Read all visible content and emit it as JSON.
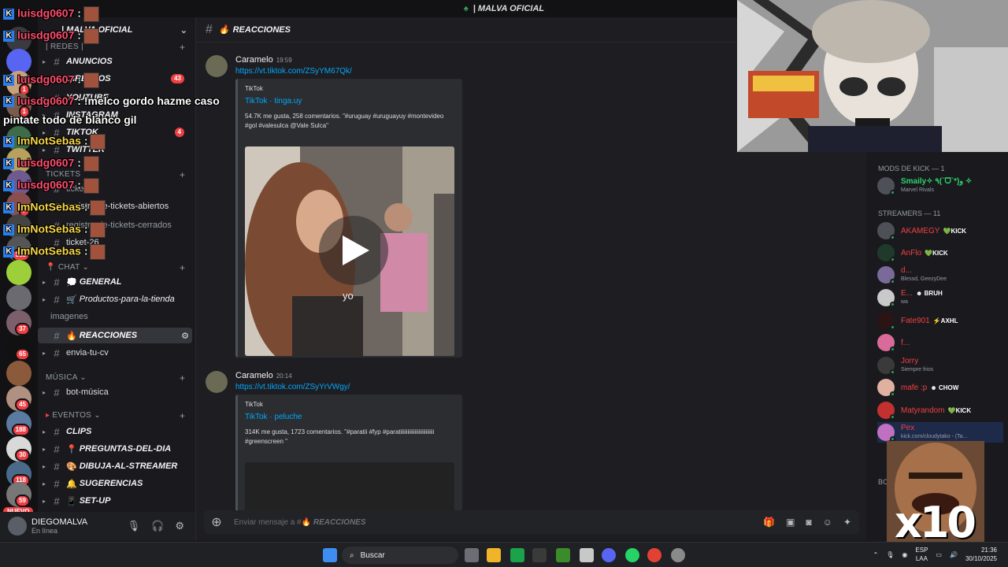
{
  "window": {
    "title": "| MALVA OFICIAL"
  },
  "server": {
    "name": "| MALVA OFICIAL"
  },
  "rail": {
    "badges": [
      "1",
      "1",
      "7",
      "4",
      "5",
      "7",
      "2",
      "383",
      "37",
      "65",
      "45",
      "188",
      "30",
      "118",
      "59"
    ],
    "nuevo_label": "NUEVO"
  },
  "sidebar": {
    "categories": {
      "redes": "| REDES |",
      "tickets": "TICKETS",
      "chat": "CHAT",
      "musica": "MÚSICA",
      "eventos": "EVENTOS"
    },
    "redes_channels": [
      "ANUNCIOS",
      "DIRECTOS",
      "YOUTUBE",
      "INSTAGRAM",
      "TIKTOK",
      "TWITTER"
    ],
    "directos_count": "43",
    "tiktok_count": "4",
    "tickets_channels": [
      "tickets",
      "registro-de-tickets-abiertos",
      "registro-de-tickets-cerrados",
      "ticket-26"
    ],
    "chat_channels": [
      "GENERAL",
      "Productos-para-la-tienda",
      "imagenes",
      "REACCIONES",
      "envia-tu-cv"
    ],
    "musica_channels": [
      "bot-música"
    ],
    "eventos_channels": [
      "CLIPS",
      "PREGUNTAS-DEL-DIA",
      "DIBUJA-AL-STREAMER",
      "SUGERENCIAS",
      "SET-UP"
    ]
  },
  "user": {
    "name": "DIEGOMALVA",
    "status": "En línea"
  },
  "channel": {
    "name": "REACCIONES"
  },
  "messages": [
    {
      "author": "Caramelo",
      "time": "19:59",
      "link": "https://vt.tiktok.com/ZSyYM67Qk/",
      "provider": "TikTok",
      "title": "TikTok · tinga.uy",
      "description": "54.7K me gusta, 258 comentarios. \"#uruguay #uruguayuy #montevideo #gol #valesulca @Vale Sulca\"",
      "video_caption": "yo"
    },
    {
      "author": "Caramelo",
      "time": "20:14",
      "link": "https://vt.tiktok.com/ZSyYrVWgy/",
      "provider": "TikTok",
      "title": "TikTok · peluche",
      "description": "314K me gusta, 1723 comentarios. \"#paratii #fyp #paratiiiiiiiiiiiiiiiiiiiiiiii #greenscreen \""
    }
  ],
  "composer": {
    "prefix": "Enviar mensaje a #",
    "channel": "REACCIONES"
  },
  "members": {
    "mods_header": "MODS DE KICK — 1",
    "streamers_header": "STREAMERS — 11",
    "bots_header": "BO",
    "mods": [
      {
        "name": "Smaily✧ ٩(ˊᗜˋ*)و ✧",
        "status": "Marvel Rivals",
        "color": "#2dd36f"
      }
    ],
    "streamers": [
      {
        "name": "AKAMEGY",
        "tag": "KICK",
        "status": "",
        "color": "#f23f43"
      },
      {
        "name": "AnFlo",
        "tag": "KICK",
        "status": "",
        "color": "#f23f43"
      },
      {
        "name": "d...",
        "tag": "",
        "status": "Blessd, GeezyDee",
        "color": "#f23f43"
      },
      {
        "name": "E...",
        "tag": "BRUH",
        "status": "wa",
        "color": "#f23f43"
      },
      {
        "name": "Fate901",
        "tag": "AXHL",
        "status": "",
        "color": "#f23f43"
      },
      {
        "name": "f...",
        "tag": "",
        "status": "",
        "color": "#f23f43"
      },
      {
        "name": "Jorry",
        "tag": "",
        "status": "Siempre frios",
        "color": "#f23f43"
      },
      {
        "name": "mafe :p",
        "tag": "CHOW",
        "status": "",
        "color": "#f23f43"
      },
      {
        "name": "Matyrandom",
        "tag": "KICK",
        "status": "",
        "color": "#f23f43"
      },
      {
        "name": "Pex",
        "tag": "",
        "status": "kick.com/cloudytako - (Ta...",
        "color": "#f23f43"
      }
    ]
  },
  "overlay": [
    {
      "user": "luisdg0607",
      "text": ":",
      "color": "#ff4d6d"
    },
    {
      "user": "luisdg0607",
      "text": ":",
      "color": "#ff4d6d"
    },
    {
      "user": "luisdg0607",
      "text": ":",
      "color": "#ff4d6d"
    },
    {
      "user": "luisdg0607",
      "text": ": !melco gordo hazme caso",
      "color": "#ff4d6d"
    },
    {
      "user": "",
      "text": "pintate todo de blanco gil",
      "color": "#ffffff"
    },
    {
      "user": "ImNotSebas",
      "text": ":",
      "color": "#f5d547"
    },
    {
      "user": "luisdg0607",
      "text": ":",
      "color": "#ff4d6d"
    },
    {
      "user": "luisdg0607",
      "text": ":",
      "color": "#ff4d6d"
    },
    {
      "user": "ImNotSebas",
      "text": ":",
      "color": "#f5d547"
    },
    {
      "user": "ImNotSebas",
      "text": ":",
      "color": "#f5d547"
    },
    {
      "user": "ImNotSebas",
      "text": ":",
      "color": "#f5d547"
    }
  ],
  "meme": {
    "text": "x10"
  },
  "taskbar": {
    "search_label": "Buscar",
    "lang_line1": "ESP",
    "lang_line2": "LAA",
    "time": "21:36",
    "date": "30/10/2025"
  }
}
